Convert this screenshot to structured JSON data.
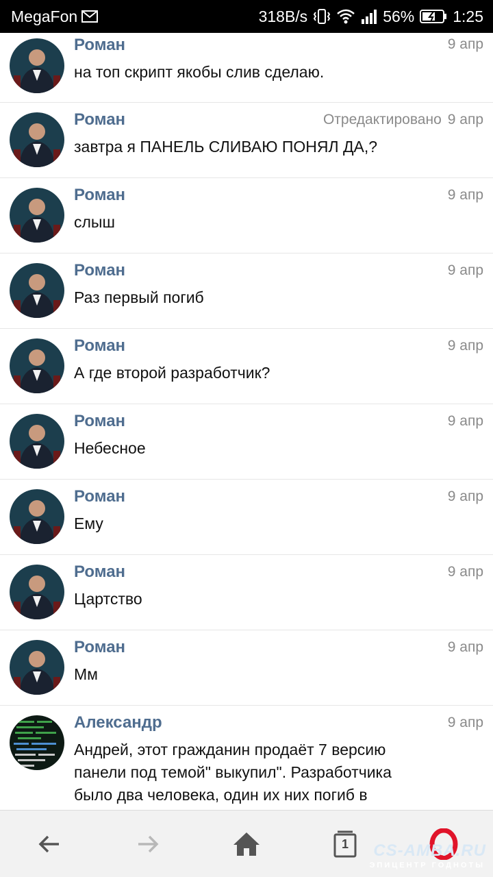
{
  "status_bar": {
    "carrier": "MegaFon",
    "net_speed": "318B/s",
    "battery": "56%",
    "time": "1:25"
  },
  "messages": [
    {
      "author": "Роман",
      "edited": "",
      "date": "9 апр",
      "text": "на топ скрипт якобы слив сделаю."
    },
    {
      "author": "Роман",
      "edited": "Отредактировано",
      "date": "9 апр",
      "text": "завтра я ПАНЕЛЬ СЛИВАЮ ПОНЯЛ ДА,?"
    },
    {
      "author": "Роман",
      "edited": "",
      "date": "9 апр",
      "text": "слыш"
    },
    {
      "author": "Роман",
      "edited": "",
      "date": "9 апр",
      "text": "Раз первый погиб"
    },
    {
      "author": "Роман",
      "edited": "",
      "date": "9 апр",
      "text": "А где второй разработчик?"
    },
    {
      "author": "Роман",
      "edited": "",
      "date": "9 апр",
      "text": "Небесное"
    },
    {
      "author": "Роман",
      "edited": "",
      "date": "9 апр",
      "text": "Ему"
    },
    {
      "author": "Роман",
      "edited": "",
      "date": "9 апр",
      "text": "Цартство"
    },
    {
      "author": "Роман",
      "edited": "",
      "date": "9 апр",
      "text": "Мм"
    },
    {
      "author": "Александр",
      "edited": "",
      "date": "9 апр",
      "text": "Андрей, этот гражданин продаёт 7 версию панели под темой\" выкупил\". Разработчика было два человека, один их них погиб в"
    }
  ],
  "bottom_nav": {
    "tab_count": "1",
    "icons": [
      "back-arrow-icon",
      "forward-arrow-icon",
      "home-icon",
      "tabs-icon",
      "opera-icon"
    ]
  },
  "watermark": {
    "main": "CS-AMBA.RU",
    "sub": "ЭПИЦЕНТР ГОДНОТЫ"
  },
  "colors": {
    "author": "#4f6d8f",
    "meta": "#8a8a8a",
    "opera_red": "#e0142a"
  }
}
